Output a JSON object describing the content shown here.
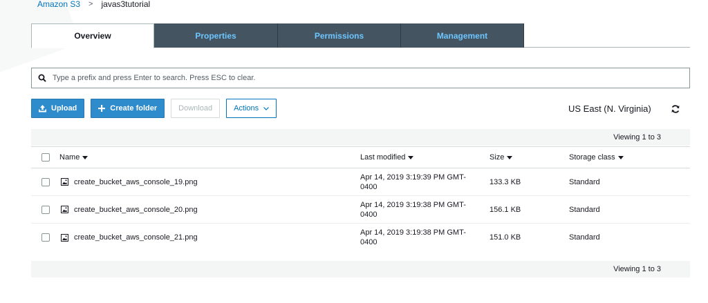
{
  "breadcrumb": {
    "root": "Amazon S3",
    "separator": ">",
    "current": "javas3tutorial"
  },
  "tabs": [
    {
      "label": "Overview",
      "active": true
    },
    {
      "label": "Properties",
      "active": false
    },
    {
      "label": "Permissions",
      "active": false
    },
    {
      "label": "Management",
      "active": false
    }
  ],
  "search": {
    "placeholder": "Type a prefix and press Enter to search. Press ESC to clear.",
    "value": "",
    "icon": "search-icon"
  },
  "toolbar": {
    "upload_label": "Upload",
    "create_folder_label": "Create folder",
    "download_label": "Download",
    "actions_label": "Actions"
  },
  "region": "US East (N. Virginia)",
  "viewing": "Viewing 1 to 3",
  "table": {
    "headers": {
      "name": "Name",
      "last_modified": "Last modified",
      "size": "Size",
      "storage_class": "Storage class"
    },
    "rows": [
      {
        "name": "create_bucket_aws_console_19.png",
        "modified_line1": "Apr 14, 2019 3:19:39 PM GMT-",
        "modified_line2": "0400",
        "size": "133.3 KB",
        "storage_class": "Standard"
      },
      {
        "name": "create_bucket_aws_console_20.png",
        "modified_line1": "Apr 14, 2019 3:19:38 PM GMT-",
        "modified_line2": "0400",
        "size": "156.1 KB",
        "storage_class": "Standard"
      },
      {
        "name": "create_bucket_aws_console_21.png",
        "modified_line1": "Apr 14, 2019 3:19:38 PM GMT-",
        "modified_line2": "0400",
        "size": "151.0 KB",
        "storage_class": "Standard"
      }
    ]
  },
  "colors": {
    "primary": "#2e8ccc",
    "link": "#0073bb",
    "tab_dark": "#445561",
    "tab_text": "#6ec6ff"
  }
}
